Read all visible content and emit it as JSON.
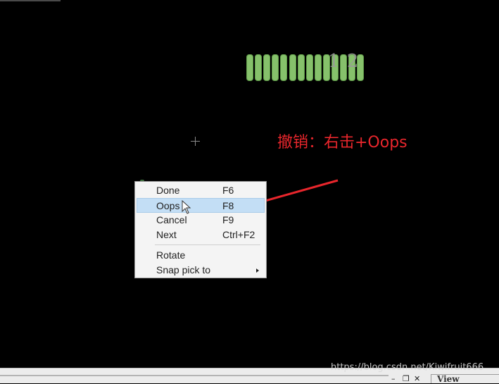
{
  "canvas": {
    "ref_label": "1 2",
    "pad_count": 14,
    "pad_color": "#86c16b"
  },
  "annotation": {
    "text": "撤销：右击+Oops",
    "color": "#e8262c"
  },
  "context_menu": {
    "items": [
      {
        "label": "Done",
        "shortcut": "F6"
      },
      {
        "label": "Oops",
        "shortcut": "F8"
      },
      {
        "label": "Cancel",
        "shortcut": "F9"
      },
      {
        "label": "Next",
        "shortcut": "Ctrl+F2"
      }
    ],
    "items2": [
      {
        "label": "Rotate"
      },
      {
        "label": "Snap pick to"
      }
    ],
    "highlight_color": "#c3def5"
  },
  "window_controls": {
    "minimize": "–",
    "restore": "❐",
    "close": "✕"
  },
  "bottom": {
    "view_tab": "View"
  },
  "watermark": "https://blog.csdn.net/Kiwifruit666"
}
